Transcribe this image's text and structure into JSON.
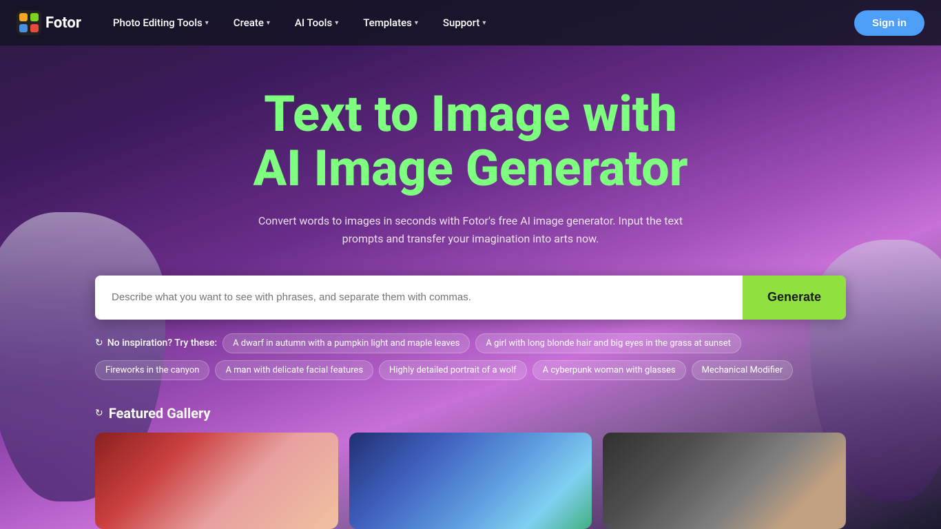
{
  "logo": {
    "text": "Fotor"
  },
  "navbar": {
    "items": [
      {
        "id": "photo-editing-tools",
        "label": "Photo Editing Tools",
        "hasChevron": true
      },
      {
        "id": "create",
        "label": "Create",
        "hasChevron": true
      },
      {
        "id": "ai-tools",
        "label": "AI Tools",
        "hasChevron": true
      },
      {
        "id": "templates",
        "label": "Templates",
        "hasChevron": true
      },
      {
        "id": "support",
        "label": "Support",
        "hasChevron": true
      }
    ],
    "sign_in_label": "Sign in"
  },
  "hero": {
    "title_line1": "Text to Image with",
    "title_line2": "AI Image Generator",
    "subtitle": "Convert words to images in seconds with Fotor's free AI image generator. Input the text prompts and transfer your imagination into arts now."
  },
  "search": {
    "placeholder": "Describe what you want to see with phrases, and separate them with commas.",
    "generate_label": "Generate"
  },
  "inspiration": {
    "label": "No inspiration? Try these:",
    "tags_row1": [
      "A dwarf in autumn with a pumpkin light and maple leaves",
      "A girl with long blonde hair and big eyes in the grass at sunset"
    ],
    "tags_row2": [
      "Fireworks in the canyon",
      "A man with delicate facial features",
      "Highly detailed portrait of a wolf",
      "A cyberpunk woman with glasses",
      "Mechanical Modifier"
    ]
  },
  "gallery": {
    "title": "Featured Gallery",
    "cards": [
      {
        "id": "card-1",
        "alt": "Red artistic image"
      },
      {
        "id": "card-2",
        "alt": "Blue space image"
      },
      {
        "id": "card-3",
        "alt": "Grey artistic image"
      }
    ]
  }
}
